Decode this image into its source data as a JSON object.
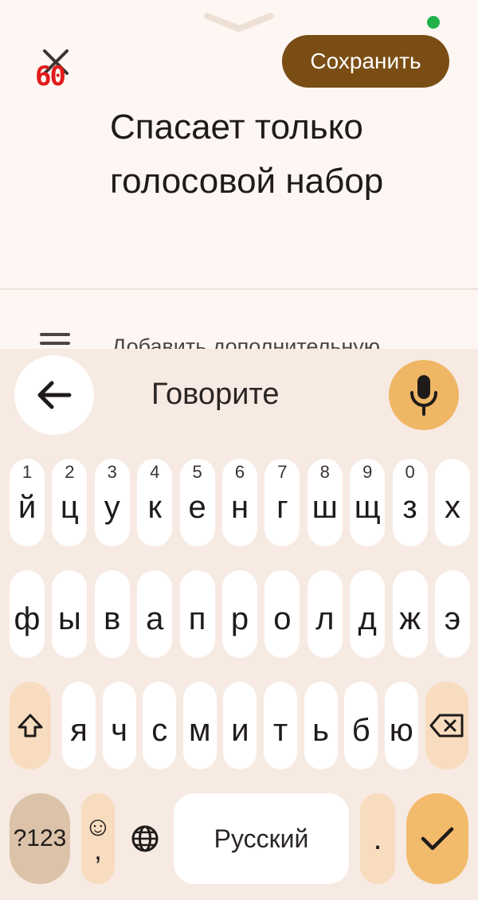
{
  "editor": {
    "save_label": "Сохранить",
    "badge_text": "60",
    "note_text": "Спасает только голосовой набор",
    "add_label": "Добавить дополнительную"
  },
  "keyboard": {
    "voice_prompt": "Говорите",
    "row1": [
      {
        "key": "й",
        "hint": "1"
      },
      {
        "key": "ц",
        "hint": "2"
      },
      {
        "key": "у",
        "hint": "3"
      },
      {
        "key": "к",
        "hint": "4"
      },
      {
        "key": "е",
        "hint": "5"
      },
      {
        "key": "н",
        "hint": "6"
      },
      {
        "key": "г",
        "hint": "7"
      },
      {
        "key": "ш",
        "hint": "8"
      },
      {
        "key": "щ",
        "hint": "9"
      },
      {
        "key": "з",
        "hint": "0"
      },
      {
        "key": "х",
        "hint": ""
      }
    ],
    "row2": [
      "ф",
      "ы",
      "в",
      "а",
      "п",
      "р",
      "о",
      "л",
      "д",
      "ж",
      "э"
    ],
    "row3": [
      "я",
      "ч",
      "с",
      "м",
      "и",
      "т",
      "ь",
      "б",
      "ю"
    ],
    "num_label": "?123",
    "emoji_symbol": "☺",
    "comma_label": ",",
    "space_label": "Русский",
    "period_label": "."
  },
  "colors": {
    "save_button": "#7a4d14",
    "mic_button": "#efb665",
    "enter_button": "#f2bb6b",
    "badge": "#e11b1b",
    "status_dot": "#1fb24a"
  }
}
